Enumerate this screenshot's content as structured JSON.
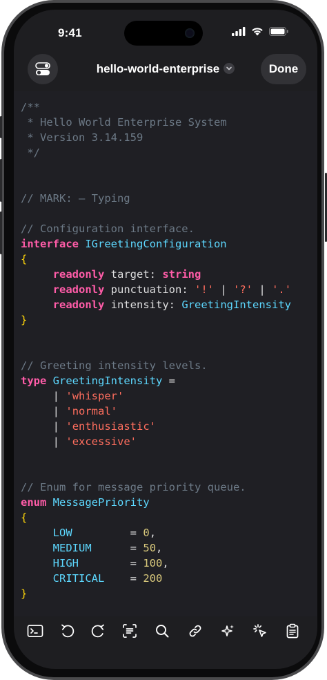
{
  "status_bar": {
    "time": "9:41"
  },
  "header": {
    "menu_icon": "toggle-icon",
    "title": "hello-world-enterprise",
    "chevron_icon": "chevron-down-icon",
    "done_label": "Done"
  },
  "code": {
    "l1": "/**",
    "l2": " * Hello World Enterprise System",
    "l3": " * Version 3.14.159",
    "l4": " */",
    "mark_comment": "// MARK: – Typing",
    "config_comment": "// Configuration interface.",
    "kw_interface": "interface",
    "iface_name": "IGreetingConfiguration",
    "open_brace1": "{",
    "kw_readonly1": "readonly",
    "prop_target": "target:",
    "type_string": "string",
    "kw_readonly2": "readonly",
    "prop_punct": "punctuation:",
    "str_excl": "'!'",
    "pipe_a": "|",
    "str_q": "'?'",
    "pipe_b": "|",
    "str_dot": "'.'",
    "kw_readonly3": "readonly",
    "prop_intensity": "intensity:",
    "type_intensity": "GreetingIntensity",
    "close_brace1": "}",
    "intensity_comment": "// Greeting intensity levels.",
    "kw_type": "type",
    "type_name": "GreetingIntensity",
    "eq": "=",
    "pipe1": "|",
    "str_whisper": "'whisper'",
    "pipe2": "|",
    "str_normal": "'normal'",
    "pipe3": "|",
    "str_enthusiastic": "'enthusiastic'",
    "pipe4": "|",
    "str_excessive": "'excessive'",
    "enum_comment": "// Enum for message priority queue.",
    "kw_enum": "enum",
    "enum_name": "MessagePriority",
    "open_brace2": "{",
    "low": "LOW",
    "low_eq": "=",
    "low_val": "0",
    "medium": "MEDIUM",
    "medium_eq": "=",
    "medium_val": "50",
    "high": "HIGH",
    "high_eq": "=",
    "high_val": "100",
    "critical": "CRITICAL",
    "critical_eq": "=",
    "critical_val": "200",
    "comma": ",",
    "close_brace2": "}"
  },
  "toolbar": {
    "items": [
      "terminal-icon",
      "undo-icon",
      "redo-icon",
      "format-icon",
      "search-icon",
      "link-icon",
      "sparkles-icon",
      "cursor-click-icon",
      "clipboard-icon"
    ]
  },
  "colors": {
    "background": "#1f1f24",
    "comment": "#6c7986",
    "keyword": "#ff5ca8",
    "type": "#5dd8ff",
    "string": "#ff6e5e",
    "number": "#d9c97c",
    "brace": "#ffd60a"
  }
}
